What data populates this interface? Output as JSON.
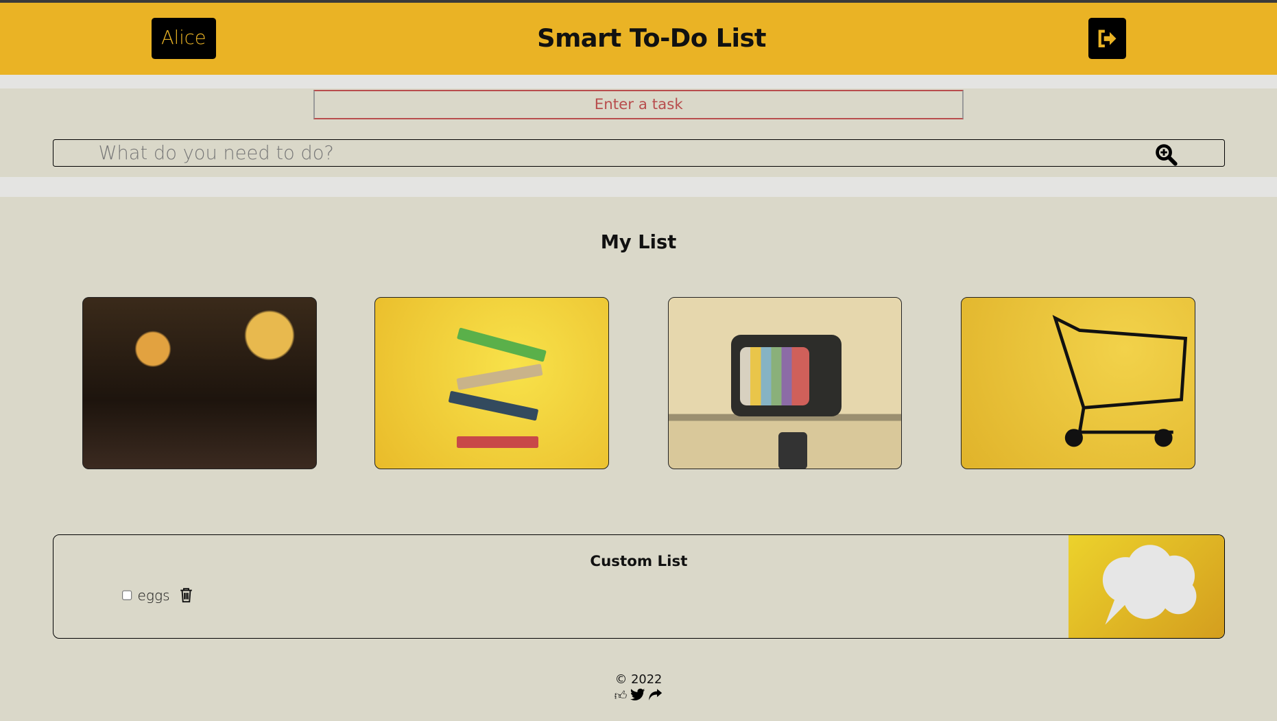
{
  "header": {
    "user_label": "Alice",
    "title": "Smart To-Do List"
  },
  "task_input": {
    "placeholder": "Enter a task"
  },
  "search": {
    "placeholder": "What do you need to do?"
  },
  "main": {
    "heading": "My List",
    "categories": [
      "restaurant",
      "books",
      "tv",
      "shopping"
    ]
  },
  "custom_list": {
    "title": "Custom List",
    "items": [
      {
        "label": "eggs",
        "checked": false
      }
    ]
  },
  "footer": {
    "copyright": "© 2022"
  },
  "colors": {
    "brand": "#eab325",
    "background": "#dad8c9",
    "accent_red": "#b84d4d"
  }
}
